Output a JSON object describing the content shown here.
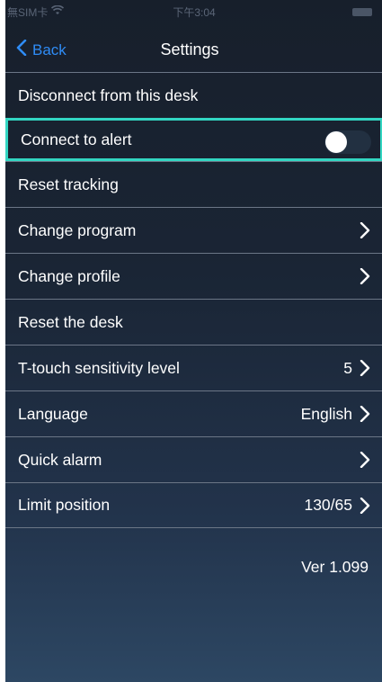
{
  "status_bar": {
    "carrier": "無SIM卡",
    "time": "下午3:04"
  },
  "nav": {
    "back_label": "Back",
    "title": "Settings"
  },
  "items": [
    {
      "label": "Disconnect from this desk",
      "value": ""
    },
    {
      "label": "Connect to alert",
      "value": "",
      "toggle": false
    },
    {
      "label": "Reset tracking",
      "value": ""
    },
    {
      "label": "Change program",
      "value": ""
    },
    {
      "label": "Change profile",
      "value": ""
    },
    {
      "label": "Reset the desk",
      "value": ""
    },
    {
      "label": "T-touch sensitivity level",
      "value": "5"
    },
    {
      "label": "Language",
      "value": "English"
    },
    {
      "label": "Quick alarm",
      "value": ""
    },
    {
      "label": "Limit position",
      "value": "130/65"
    }
  ],
  "version": "Ver 1.099",
  "colors": {
    "accent": "#2f8cf6",
    "highlight": "#32d6c2",
    "background": "#1a2535"
  },
  "icons": {
    "back": "chevron-left-icon",
    "disclosure": "chevron-right-icon",
    "wifi": "wifi-icon",
    "battery": "battery-icon"
  }
}
